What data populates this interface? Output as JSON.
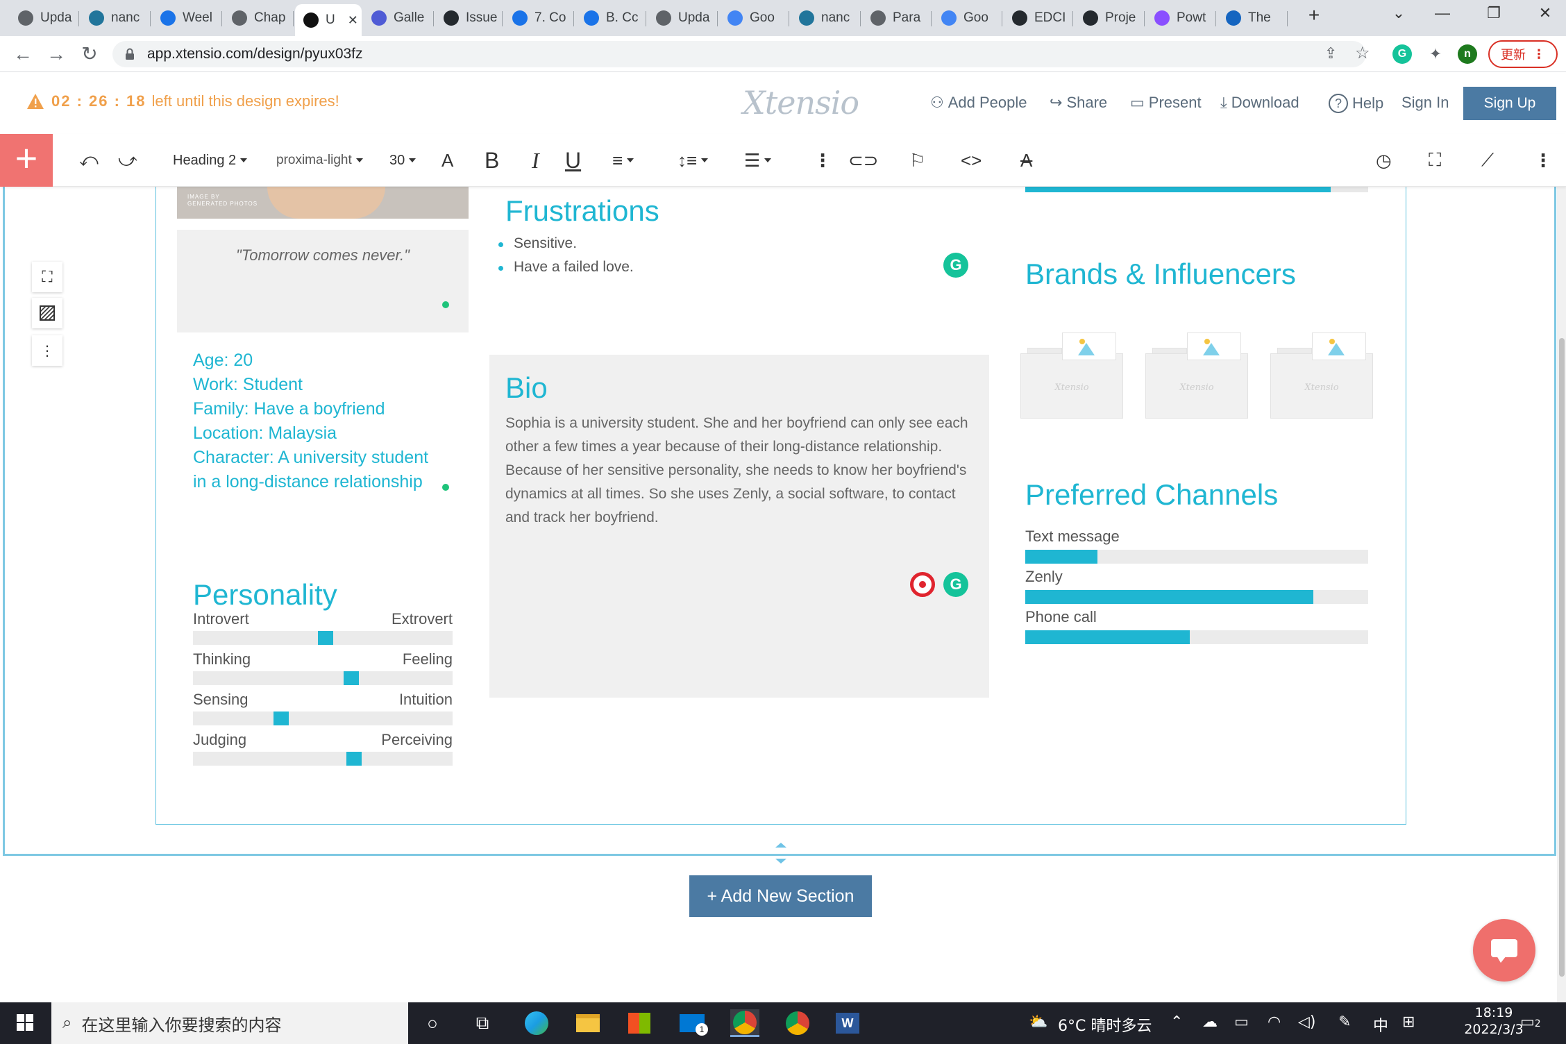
{
  "browser": {
    "tabs": [
      {
        "label": "Upda",
        "icon": "globe-icon",
        "color": "#5f6368"
      },
      {
        "label": "nanc",
        "icon": "wordpress-icon",
        "color": "#21759b"
      },
      {
        "label": "Weel",
        "icon": "cursor-icon",
        "color": "#1a73e8"
      },
      {
        "label": "Chap",
        "icon": "globe-icon",
        "color": "#5f6368"
      },
      {
        "label": "U",
        "icon": "xtensio-icon",
        "color": "#111111",
        "active": true
      },
      {
        "label": "Galle",
        "icon": "terminal-icon",
        "color": "#4f5bd5"
      },
      {
        "label": "Issue",
        "icon": "github-icon",
        "color": "#24292e"
      },
      {
        "label": "7. Co",
        "icon": "cursor-icon",
        "color": "#1a73e8"
      },
      {
        "label": "B. Cc",
        "icon": "cursor-icon",
        "color": "#1a73e8"
      },
      {
        "label": "Upda",
        "icon": "globe-icon",
        "color": "#5f6368"
      },
      {
        "label": "Goo",
        "icon": "google-translate-icon",
        "color": "#4285f4"
      },
      {
        "label": "nanc",
        "icon": "wordpress-icon",
        "color": "#21759b"
      },
      {
        "label": "Para",
        "icon": "feather-icon",
        "color": "#5f6368"
      },
      {
        "label": "Goo",
        "icon": "google-translate-icon",
        "color": "#4285f4"
      },
      {
        "label": "EDCI",
        "icon": "github-icon",
        "color": "#24292e"
      },
      {
        "label": "Proje",
        "icon": "github-icon",
        "color": "#24292e"
      },
      {
        "label": "Powt",
        "icon": "powtoon-icon",
        "color": "#8a4fff"
      },
      {
        "label": "The",
        "icon": "globe-icon",
        "color": "#1565c0"
      }
    ],
    "new_tab": "+",
    "url": "app.xtensio.com/design/pyux03fz",
    "update_label": "更新",
    "profile_initial": "n"
  },
  "header": {
    "expire_timer": "02 : 26 : 18",
    "expire_text": "left until this design expires!",
    "logo": "Xtensio",
    "add_people": "Add People",
    "share": "Share",
    "present": "Present",
    "download": "Download",
    "help": "Help",
    "sign_in": "Sign In",
    "sign_up": "Sign Up"
  },
  "toolbar": {
    "style": "Heading 2",
    "font": "proxima-light",
    "size": "30"
  },
  "persona": {
    "photo_badge": "IMAGE BY\nGENERATED PHOTOS",
    "quote": "\"Tomorrow comes never.\"",
    "info": [
      "Age: 20",
      "Work: Student",
      "Family:  Have a boyfriend",
      "Location: Malaysia",
      "Character: A university student",
      "in a long-distance relationship"
    ],
    "personality_title": "Personality",
    "personality": [
      {
        "left": "Introvert",
        "right": "Extrovert",
        "value": 0.51
      },
      {
        "left": "Thinking",
        "right": "Feeling",
        "value": 0.61
      },
      {
        "left": "Sensing",
        "right": "Intuition",
        "value": 0.34
      },
      {
        "left": "Judging",
        "right": "Perceiving",
        "value": 0.62
      }
    ],
    "frustrations_title": "Frustrations",
    "frustrations": [
      "Sensitive.",
      "Have a failed love."
    ],
    "bio_title": "Bio",
    "bio": "Sophia is a university student. She and her boyfriend can only see each other a few times a year because of their long-distance relationship. Because of her sensitive personality, she needs to know her boyfriend's dynamics at all times. So she uses Zenly, a social software, to contact and track her boyfriend.",
    "top_bar_level": 0.89,
    "brands_title": "Brands & Influencers",
    "brand_watermark": "Xtensio",
    "channels_title": "Preferred Channels",
    "channels": [
      {
        "label": "Text message",
        "value": 0.21
      },
      {
        "label": "Zenly",
        "value": 0.84
      },
      {
        "label": "Phone call",
        "value": 0.48
      }
    ]
  },
  "canvas": {
    "add_section": "+ Add New Section"
  },
  "taskbar": {
    "search_placeholder": "在这里输入你要搜索的内容",
    "weather": "6°C  晴时多云",
    "ime": "中",
    "time": "18:19",
    "date": "2022/3/3",
    "mail_badge": "1",
    "notif_count": "2"
  }
}
